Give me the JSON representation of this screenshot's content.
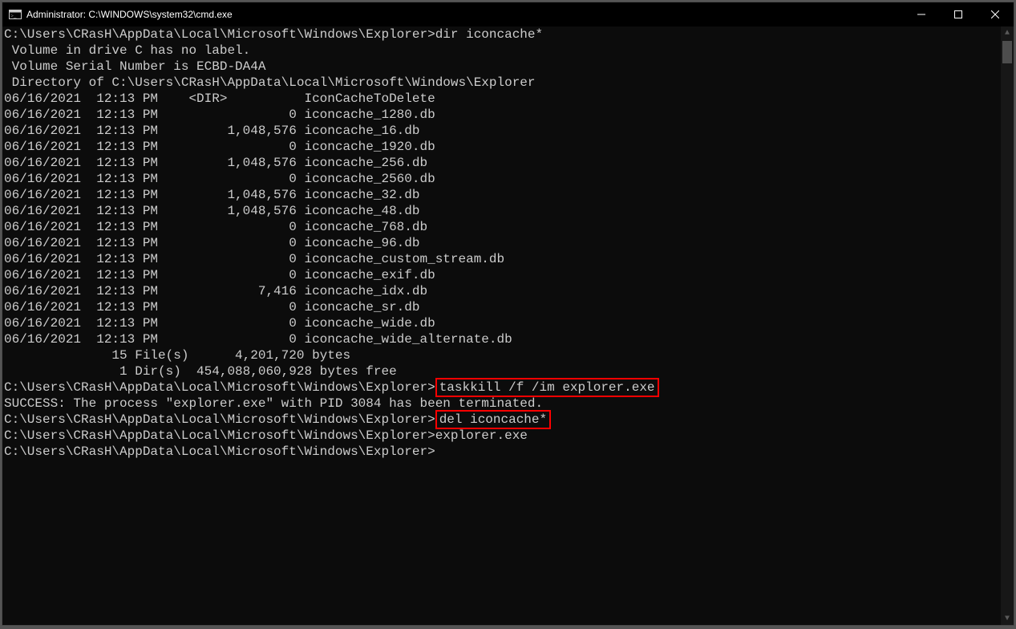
{
  "titlebar": {
    "icon_name": "cmd-icon",
    "title": "Administrator: C:\\WINDOWS\\system32\\cmd.exe",
    "min_label": "Minimize",
    "max_label": "Maximize",
    "close_label": "Close"
  },
  "console": {
    "prompt_path": "C:\\Users\\CRasH\\AppData\\Local\\Microsoft\\Windows\\Explorer>",
    "cmd1": "dir iconcache*",
    "volume_line": " Volume in drive C has no label.",
    "serial_line": " Volume Serial Number is ECBD-DA4A",
    "dir_of_line": " Directory of C:\\Users\\CRasH\\AppData\\Local\\Microsoft\\Windows\\Explorer",
    "listing": [
      "06/16/2021  12:13 PM    <DIR>          IconCacheToDelete",
      "06/16/2021  12:13 PM                 0 iconcache_1280.db",
      "06/16/2021  12:13 PM         1,048,576 iconcache_16.db",
      "06/16/2021  12:13 PM                 0 iconcache_1920.db",
      "06/16/2021  12:13 PM         1,048,576 iconcache_256.db",
      "06/16/2021  12:13 PM                 0 iconcache_2560.db",
      "06/16/2021  12:13 PM         1,048,576 iconcache_32.db",
      "06/16/2021  12:13 PM         1,048,576 iconcache_48.db",
      "06/16/2021  12:13 PM                 0 iconcache_768.db",
      "06/16/2021  12:13 PM                 0 iconcache_96.db",
      "06/16/2021  12:13 PM                 0 iconcache_custom_stream.db",
      "06/16/2021  12:13 PM                 0 iconcache_exif.db",
      "06/16/2021  12:13 PM             7,416 iconcache_idx.db",
      "06/16/2021  12:13 PM                 0 iconcache_sr.db",
      "06/16/2021  12:13 PM                 0 iconcache_wide.db",
      "06/16/2021  12:13 PM                 0 iconcache_wide_alternate.db"
    ],
    "summary_files": "              15 File(s)      4,201,720 bytes",
    "summary_dirs": "               1 Dir(s)  454,088,060,928 bytes free",
    "cmd2": "taskkill /f /im explorer.exe",
    "cmd2_result": "SUCCESS: The process \"explorer.exe\" with PID 3084 has been terminated.",
    "cmd3": "del iconcache*",
    "cmd4": "explorer.exe"
  },
  "scrollbar": {
    "up_glyph": "▲",
    "down_glyph": "▼"
  }
}
